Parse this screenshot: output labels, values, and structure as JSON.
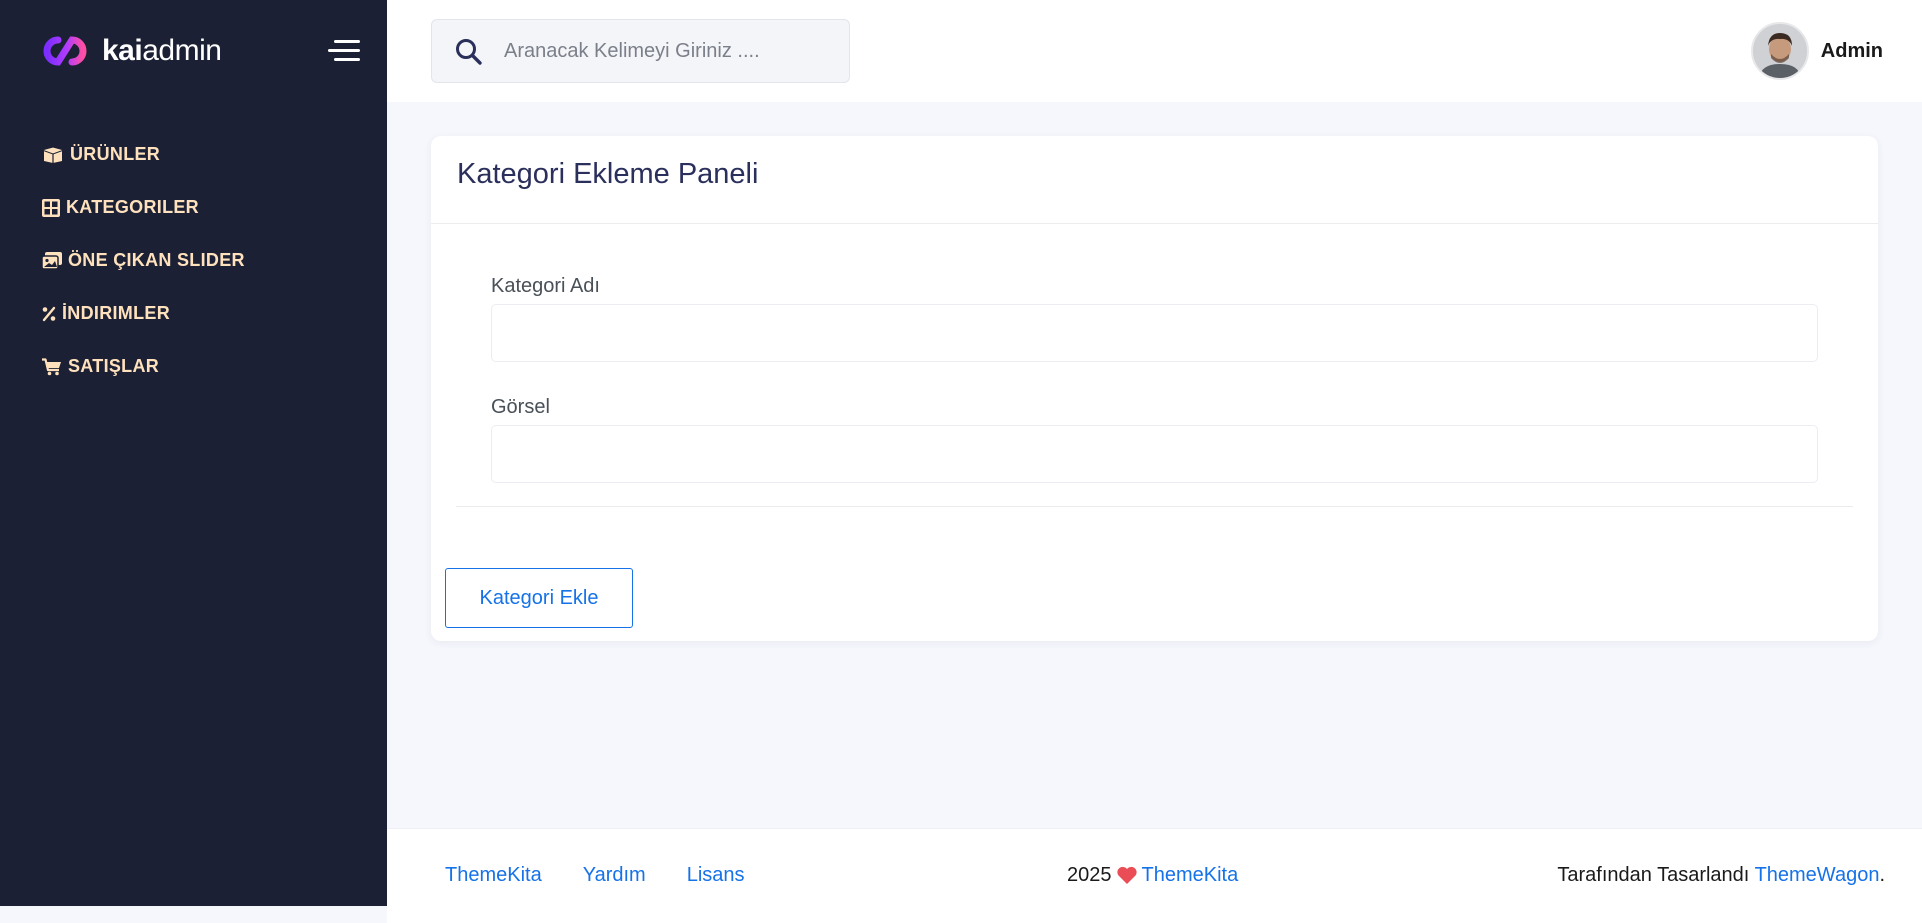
{
  "brand": {
    "bold": "kai",
    "light": "admin"
  },
  "sidebar": {
    "items": [
      {
        "label": "ÜRÜNLER",
        "icon": "box-open-icon"
      },
      {
        "label": "KATEGORILER",
        "icon": "grid-table-icon"
      },
      {
        "label": "ÖNE ÇIKAN SLIDER",
        "icon": "images-icon"
      },
      {
        "label": "İNDIRIMLER",
        "icon": "percent-icon"
      },
      {
        "label": "SATIŞLAR",
        "icon": "shopping-cart-icon"
      }
    ]
  },
  "search": {
    "placeholder": "Aranacak Kelimeyi Giriniz ...."
  },
  "user": {
    "name": "Admin"
  },
  "card": {
    "title": "Kategori Ekleme Paneli",
    "fields": [
      {
        "label": "Kategori Adı",
        "value": ""
      },
      {
        "label": "Görsel",
        "value": ""
      }
    ],
    "submit_label": "Kategori Ekle"
  },
  "footer": {
    "links": [
      "ThemeKita",
      "Yardım",
      "Lisans"
    ],
    "year": "2025",
    "center_link": "ThemeKita",
    "designed_by_text": "Tarafından Tasarlandı",
    "designer_link": "ThemeWagon",
    "suffix": "."
  },
  "colors": {
    "sidebar_bg": "#1b2035",
    "nav_text": "#ffe2bd",
    "accent": "#1572e8",
    "heart": "#ea4d56",
    "page_bg": "#f5f7fd"
  }
}
